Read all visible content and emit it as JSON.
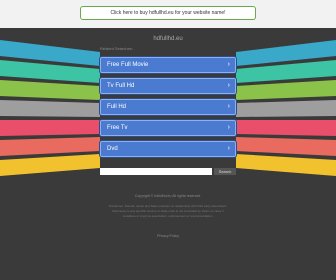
{
  "banner": {
    "text": "Click here to buy hdfullhd.eu for your website name!"
  },
  "domain": "hdfullhd.eu",
  "related_label": "Related Searches:",
  "links": [
    {
      "label": "Free Full Movie"
    },
    {
      "label": "Tv Full Hd"
    },
    {
      "label": "Full Hd"
    },
    {
      "label": "Free Tv"
    },
    {
      "label": "Dvd"
    }
  ],
  "search": {
    "placeholder": "",
    "button": "Search"
  },
  "footer": {
    "copyright": "Copyright © hdfullhd.eu All rights reserved.",
    "disclaimer": "Disclaimer: Domain owner and Sedo maintain no relationship with third party advertisers. Reference to any specific service or trade mark is not controlled by Sedo nor does it constitute or imply its association, endorsement or recommendation.",
    "privacy": "Privacy Policy"
  },
  "colors": {
    "background": "#3a3a3a",
    "link_bg": "#4a7bd0",
    "stripes": [
      "#3aa8c9",
      "#3cc4a4",
      "#8bc34a",
      "#9e9e9e",
      "#e94f6b",
      "#e96a5e",
      "#f2c22e"
    ]
  }
}
